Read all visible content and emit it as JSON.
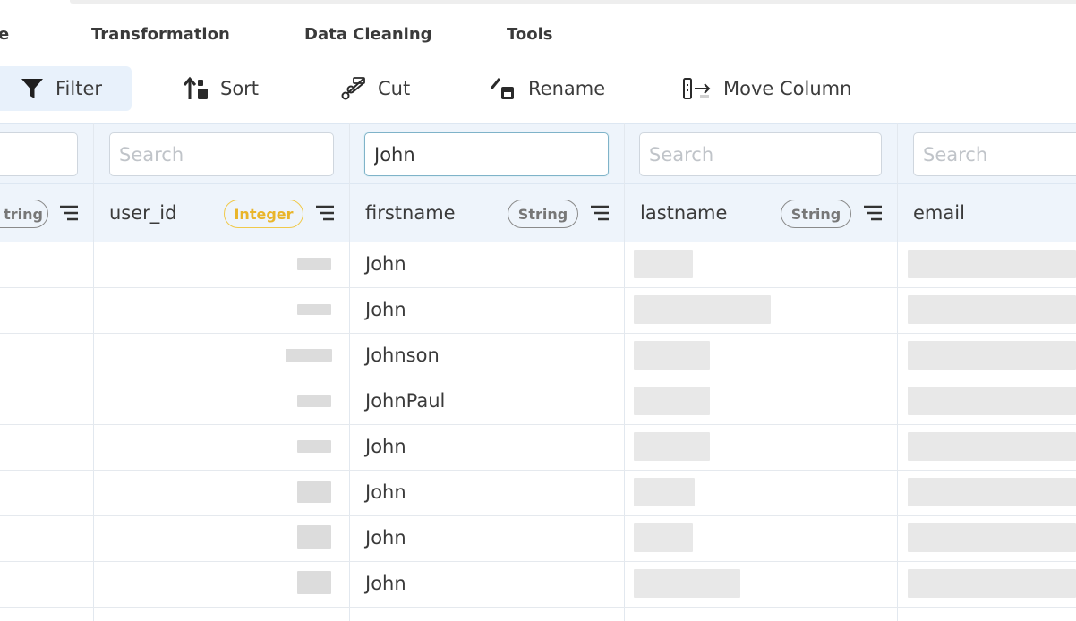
{
  "menu": {
    "items": [
      {
        "label": "e"
      },
      {
        "label": "Transformation"
      },
      {
        "label": "Data Cleaning"
      },
      {
        "label": "Tools"
      }
    ]
  },
  "toolbar": {
    "filter": "Filter",
    "sort": "Sort",
    "cut": "Cut",
    "rename": "Rename",
    "move_column": "Move Column"
  },
  "columns": [
    {
      "name": "",
      "type": "tring",
      "search_value": "",
      "search_placeholder": ""
    },
    {
      "name": "user_id",
      "type": "Integer",
      "search_value": "",
      "search_placeholder": "Search"
    },
    {
      "name": "firstname",
      "type": "String",
      "search_value": "John",
      "search_placeholder": "Search"
    },
    {
      "name": "lastname",
      "type": "String",
      "search_value": "",
      "search_placeholder": "Search"
    },
    {
      "name": "email",
      "type": "",
      "search_value": "",
      "search_placeholder": "Search"
    }
  ],
  "rows": [
    {
      "firstname": "John"
    },
    {
      "firstname": "John"
    },
    {
      "firstname": "Johnson"
    },
    {
      "firstname": "JohnPaul"
    },
    {
      "firstname": "John"
    },
    {
      "firstname": "John"
    },
    {
      "firstname": "John"
    },
    {
      "firstname": "John"
    }
  ],
  "colors": {
    "accent_bg": "#e8f1fb",
    "header_bg": "#eef4fb",
    "integer_badge": "#f0c94a",
    "focus_border": "#7fb3c9"
  }
}
